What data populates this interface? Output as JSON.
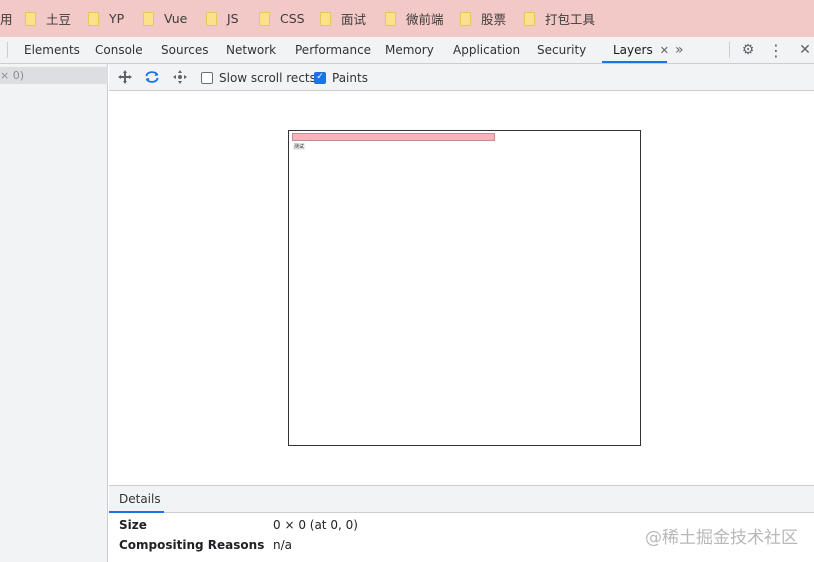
{
  "bookmarks": {
    "partial_label": "用",
    "items": [
      {
        "label": "土豆"
      },
      {
        "label": "YP"
      },
      {
        "label": "Vue"
      },
      {
        "label": "JS"
      },
      {
        "label": "CSS"
      },
      {
        "label": "面试"
      },
      {
        "label": "微前端"
      },
      {
        "label": "股票"
      },
      {
        "label": "打包工具"
      }
    ]
  },
  "devtools_tabs": {
    "items": [
      {
        "label": "Elements"
      },
      {
        "label": "Console"
      },
      {
        "label": "Sources"
      },
      {
        "label": "Network"
      },
      {
        "label": "Performance"
      },
      {
        "label": "Memory"
      },
      {
        "label": "Application"
      },
      {
        "label": "Security"
      },
      {
        "label": "Layers",
        "active": true
      }
    ],
    "overflow_glyph": "»",
    "close_tab_glyph": "✕",
    "settings_glyph": "⚙",
    "menu_glyph": "⋮",
    "close_glyph": "✕"
  },
  "left_panel": {
    "row_label": "× 0)"
  },
  "layers_toolbar": {
    "pan_icon": "pan-mode-icon",
    "rotate_icon": "rotate-mode-icon",
    "reset_icon": "reset-transform-icon",
    "slow_scroll_label": "Slow scroll rects",
    "slow_scroll_checked": false,
    "paints_label": "Paints",
    "paints_checked": true
  },
  "canvas": {
    "layer_label": "测试"
  },
  "details": {
    "tab_label": "Details",
    "rows": [
      {
        "key": "Size",
        "value": "0 × 0 (at 0, 0)"
      },
      {
        "key": "Compositing Reasons",
        "value": "n/a"
      }
    ]
  },
  "watermark": "@稀土掘金技术社区",
  "colors": {
    "accent": "#1a73e8",
    "bookmark_bar": "#f2c9c6",
    "layer_fill": "#f6b3bc"
  }
}
